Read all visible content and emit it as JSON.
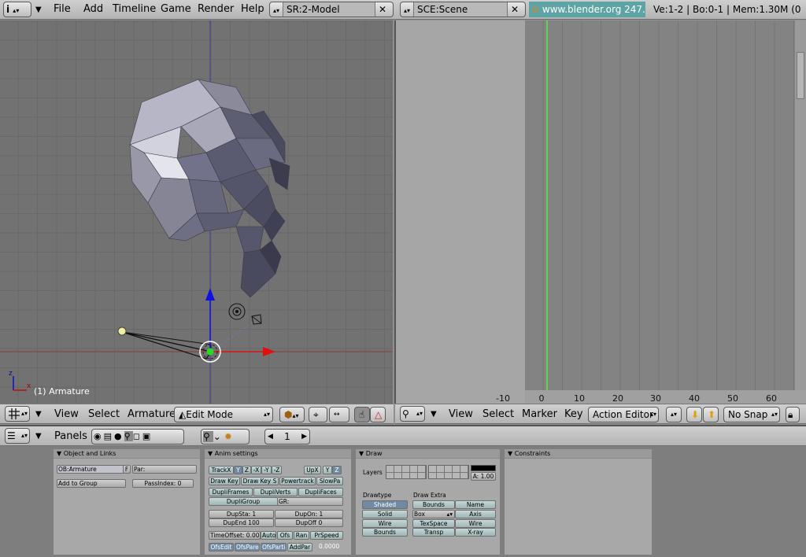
{
  "top_header": {
    "file": "File",
    "add": "Add",
    "timeline": "Timeline",
    "game": "Game",
    "render": "Render",
    "help": "Help",
    "screen": "SR:2-Model",
    "scene": "SCE:Scene",
    "url": "www.blender.org 247.1",
    "stats": "Ve:1-2 | Bo:0-1 | Mem:1.30M (0"
  },
  "view3d": {
    "object_label": "(1) Armature",
    "axis_z": "z",
    "axis_x": "x"
  },
  "view3d_header": {
    "view": "View",
    "select": "Select",
    "armature": "Armature",
    "mode": "Edit Mode"
  },
  "action_editor": {
    "ticks": [
      "-10",
      "0",
      "10",
      "20",
      "30",
      "40",
      "50",
      "60"
    ],
    "current_frame": 2
  },
  "action_header": {
    "view": "View",
    "select": "Select",
    "marker": "Marker",
    "key": "Key",
    "editor": "Action Editor",
    "snap": "No Snap"
  },
  "buttons_header": {
    "panels": "Panels",
    "frame": "1"
  },
  "panels": {
    "object_links": {
      "title": "Object and Links",
      "ob": "OB:Armature",
      "f": "F",
      "par": "Par:",
      "add_group": "Add to Group",
      "pass_index": "PassIndex: 0"
    },
    "anim": {
      "title": "Anim settings",
      "track_x": "TrackX",
      "y": "Y",
      "z": "Z",
      "nx": "-X",
      "ny": "-Y",
      "nz": "-Z",
      "upx": "UpX",
      "upy": "Y",
      "upz": "Z",
      "draw_key": "Draw Key",
      "draw_key_s": "Draw Key S",
      "powertrack": "Powertrack",
      "slowpa": "SlowPa",
      "dupliframes": "DupliFrames",
      "dupliverts": "DupliVerts",
      "duplifaces": "DupliFaces",
      "dupligroup": "DupliGroup",
      "gr": "GR:",
      "dupsta": "DupSta: 1",
      "dupon": "DupOn: 1",
      "dupend": "DupEnd 100",
      "dupoff": "DupOff 0",
      "timeoffset": "TimeOffset: 0.00",
      "auto": "Auto",
      "ofs": "Ofs",
      "ran": "Ran",
      "prspeed": "PrSpeed",
      "ofsedit": "OfsEdit",
      "ofspare": "OfsPare",
      "ofsparti": "OfsParti",
      "addpar": "AddPar",
      "value": "0.0000"
    },
    "draw": {
      "title": "Draw",
      "layers": "Layers",
      "alpha": "A: 1.00",
      "drawtype": "Drawtype",
      "shaded": "Shaded",
      "solid": "Solid",
      "wire": "Wire",
      "bounds": "Bounds",
      "drawextra": "Draw Extra",
      "bounds2": "Bounds",
      "box": "Box",
      "texspace": "TexSpace",
      "transp": "Transp",
      "name": "Name",
      "axis": "Axis",
      "wire2": "Wire",
      "xray": "X-ray"
    },
    "constraints": {
      "title": "Constraints"
    }
  }
}
